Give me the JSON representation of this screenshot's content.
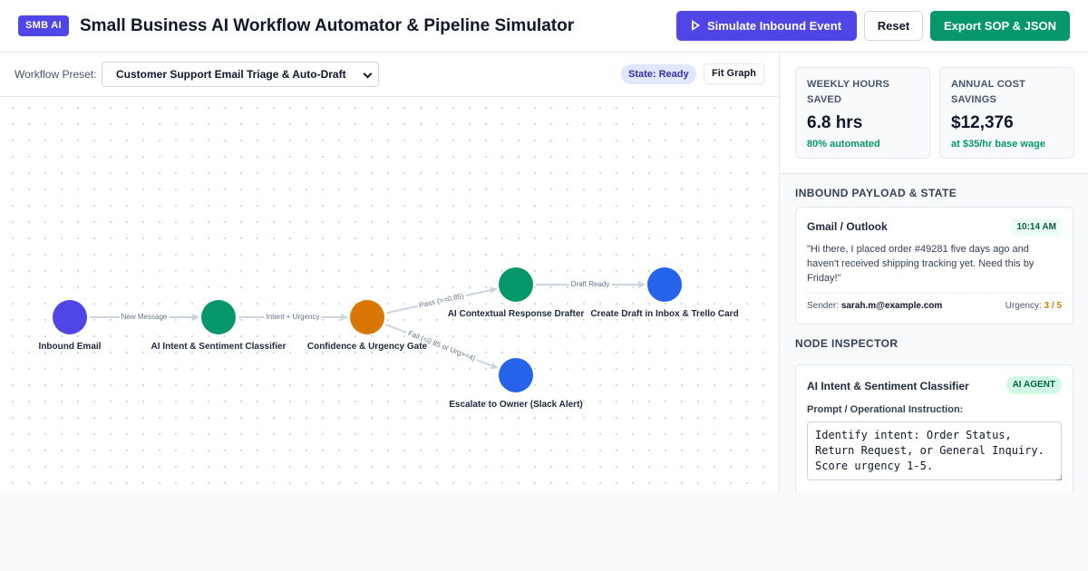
{
  "header": {
    "brand": "SMB AI",
    "title": "Small Business AI Workflow Automator & Pipeline Simulator",
    "simulate_label": "Simulate Inbound Event",
    "reset_label": "Reset",
    "export_label": "Export SOP & JSON"
  },
  "toolbar": {
    "preset_label": "Workflow Preset:",
    "preset_value": "Customer Support Email Triage & Auto-Draft",
    "state": "State: Ready",
    "fit_label": "Fit Graph"
  },
  "graph": {
    "nodes": [
      {
        "id": "n1",
        "label": "Inbound Email",
        "color": "#4f46e5"
      },
      {
        "id": "n2",
        "label": "AI Intent & Sentiment Classifier",
        "color": "#059669"
      },
      {
        "id": "n3",
        "label": "Confidence & Urgency Gate",
        "color": "#d97706"
      },
      {
        "id": "n4",
        "label": "AI Contextual Response Drafter",
        "color": "#059669"
      },
      {
        "id": "n5",
        "label": "Create Draft in Inbox & Trello Card",
        "color": "#2563eb"
      },
      {
        "id": "n6",
        "label": "Escalate to Owner (Slack Alert)",
        "color": "#2563eb"
      }
    ],
    "edges": [
      {
        "from": "n1",
        "to": "n2",
        "label": "New Message"
      },
      {
        "from": "n2",
        "to": "n3",
        "label": "Intent + Urgency"
      },
      {
        "from": "n3",
        "to": "n4",
        "label": "Pass (>=0.85)"
      },
      {
        "from": "n4",
        "to": "n5",
        "label": "Draft Ready"
      },
      {
        "from": "n3",
        "to": "n6",
        "label": "Fail (<0.85 or Urg>=4)"
      }
    ]
  },
  "metrics": {
    "hours": {
      "label": "Weekly Hours Saved",
      "value": "6.8 hrs",
      "sub": "80% automated"
    },
    "cost": {
      "label": "Annual Cost Savings",
      "value": "$12,376",
      "sub": "at $35/hr base wage"
    }
  },
  "payload": {
    "title": "Inbound Payload & State",
    "source": "Gmail / Outlook",
    "time": "10:14 AM",
    "body": "\"Hi there, I placed order #49281 five days ago and haven't received shipping tracking yet. Need this by Friday!\"",
    "sender_label": "Sender:",
    "sender": "sarah.m@example.com",
    "urgency_label": "Urgency:",
    "urgency": "3 / 5"
  },
  "inspector": {
    "title": "Node Inspector",
    "node_name": "AI Intent & Sentiment Classifier",
    "badge": "AI AGENT",
    "prompt_label": "Prompt / Operational Instruction:",
    "prompt": "Identify intent: Order Status, Return Request, or General Inquiry. Score urgency 1-5."
  }
}
